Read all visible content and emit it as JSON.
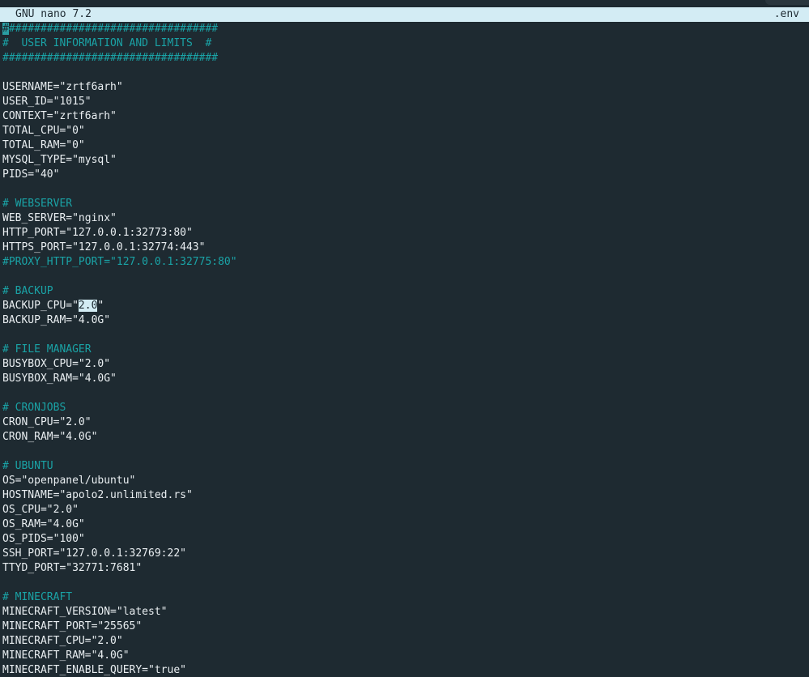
{
  "titlebar": {
    "app": "GNU nano 7.2",
    "filename": ".env"
  },
  "lines": [
    {
      "type": "comment",
      "text": "##################################"
    },
    {
      "type": "comment",
      "text": "#  USER INFORMATION AND LIMITS  #"
    },
    {
      "type": "comment",
      "text": "##################################"
    },
    {
      "type": "blank",
      "text": ""
    },
    {
      "type": "plain",
      "text": "USERNAME=\"zrtf6arh\""
    },
    {
      "type": "plain",
      "text": "USER_ID=\"1015\""
    },
    {
      "type": "plain",
      "text": "CONTEXT=\"zrtf6arh\""
    },
    {
      "type": "plain",
      "text": "TOTAL_CPU=\"0\""
    },
    {
      "type": "plain",
      "text": "TOTAL_RAM=\"0\""
    },
    {
      "type": "plain",
      "text": "MYSQL_TYPE=\"mysql\""
    },
    {
      "type": "plain",
      "text": "PIDS=\"40\""
    },
    {
      "type": "blank",
      "text": ""
    },
    {
      "type": "comment",
      "text": "# WEBSERVER"
    },
    {
      "type": "plain",
      "text": "WEB_SERVER=\"nginx\""
    },
    {
      "type": "plain",
      "text": "HTTP_PORT=\"127.0.0.1:32773:80\""
    },
    {
      "type": "plain",
      "text": "HTTPS_PORT=\"127.0.0.1:32774:443\""
    },
    {
      "type": "comment",
      "text": "#PROXY_HTTP_PORT=\"127.0.0.1:32775:80\""
    },
    {
      "type": "blank",
      "text": ""
    },
    {
      "type": "comment",
      "text": "# BACKUP"
    },
    {
      "type": "plain",
      "text": "BACKUP_CPU=\"2.0\""
    },
    {
      "type": "plain",
      "text": "BACKUP_RAM=\"4.0G\""
    },
    {
      "type": "blank",
      "text": ""
    },
    {
      "type": "comment",
      "text": "# FILE MANAGER"
    },
    {
      "type": "plain",
      "text": "BUSYBOX_CPU=\"2.0\""
    },
    {
      "type": "plain",
      "text": "BUSYBOX_RAM=\"4.0G\""
    },
    {
      "type": "blank",
      "text": ""
    },
    {
      "type": "comment",
      "text": "# CRONJOBS"
    },
    {
      "type": "plain",
      "text": "CRON_CPU=\"2.0\""
    },
    {
      "type": "plain",
      "text": "CRON_RAM=\"4.0G\""
    },
    {
      "type": "blank",
      "text": ""
    },
    {
      "type": "comment",
      "text": "# UBUNTU"
    },
    {
      "type": "plain",
      "text": "OS=\"openpanel/ubuntu\""
    },
    {
      "type": "plain",
      "text": "HOSTNAME=\"apolo2.unlimited.rs\""
    },
    {
      "type": "plain",
      "text": "OS_CPU=\"2.0\""
    },
    {
      "type": "plain",
      "text": "OS_RAM=\"4.0G\""
    },
    {
      "type": "plain",
      "text": "OS_PIDS=\"100\""
    },
    {
      "type": "plain",
      "text": "SSH_PORT=\"127.0.0.1:32769:22\""
    },
    {
      "type": "plain",
      "text": "TTYD_PORT=\"32771:7681\""
    },
    {
      "type": "blank",
      "text": ""
    },
    {
      "type": "comment",
      "text": "# MINECRAFT"
    },
    {
      "type": "plain",
      "text": "MINECRAFT_VERSION=\"latest\""
    },
    {
      "type": "plain",
      "text": "MINECRAFT_PORT=\"25565\""
    },
    {
      "type": "plain",
      "text": "MINECRAFT_CPU=\"2.0\""
    },
    {
      "type": "plain",
      "text": "MINECRAFT_RAM=\"4.0G\""
    },
    {
      "type": "plain",
      "text": "MINECRAFT_ENABLE_QUERY=\"true\""
    }
  ],
  "cursor": {
    "line": 0,
    "column": 0
  },
  "selection": {
    "line": 19,
    "start": 12,
    "end": 15
  },
  "colors": {
    "background": "#1e2a31",
    "text": "#e9eef1",
    "comment": "#1aa3a6",
    "titlebar": "#d3ecf4",
    "cursor": "#2a9ea3",
    "selection": "#d3ecf4"
  }
}
